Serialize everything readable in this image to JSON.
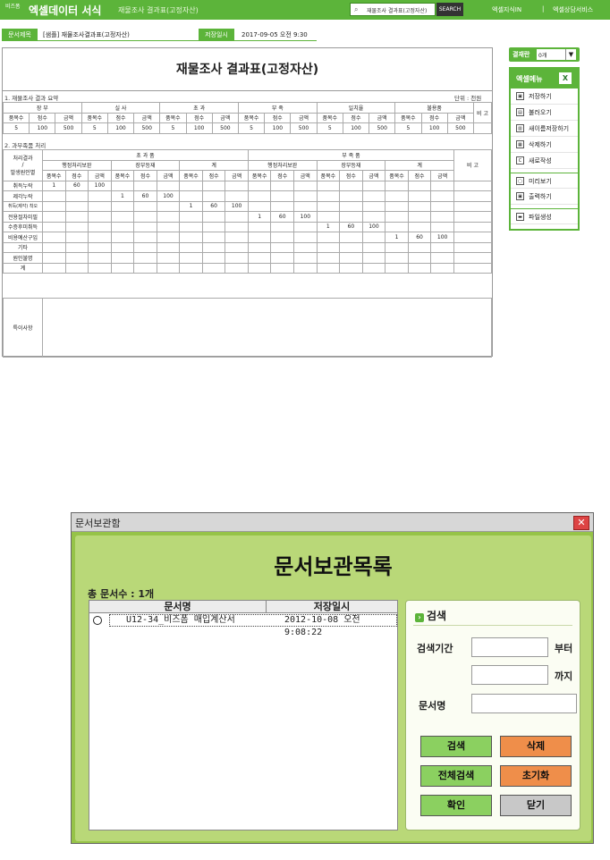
{
  "topbar": {
    "brand_small": "비즈폼",
    "brand": "엑셀데이터 서식",
    "doc_title": "재물조사 결과표(고정자산)",
    "search_value": "재물조사 결과표(고정자산)",
    "search_btn": "SEARCH",
    "link1": "엑셀지식IN",
    "sep": "|",
    "link2": "엑셀상담서비스"
  },
  "docbar": {
    "label1": "문서제목",
    "value1": "[샘플] 재물조사결과표(고정자산)",
    "label2": "저장일시",
    "value2": "2017-09-05  오전 9:30"
  },
  "sheet": {
    "title": "재물조사 결과표(고정자산)",
    "section1": "1. 재물조사 결과 요약",
    "unit": "단위 : 천원",
    "s1_groups": [
      "장 부",
      "실 사",
      "초 과",
      "부 족",
      "일치율",
      "불용품"
    ],
    "s1_note": "비 고",
    "s1_sub": [
      "품목수",
      "점수",
      "금액"
    ],
    "s1_values": [
      "5",
      "100",
      "500"
    ],
    "section2": "2. 과부족품 처리",
    "s2_rowhead": [
      "처리결과",
      "/",
      "발생원인별"
    ],
    "s2_groups": [
      "초 과 품",
      "부 족 품"
    ],
    "s2_subgroups": [
      "행정처리보완",
      "장부등재",
      "계",
      "행정처리보완",
      "장부등재",
      "계"
    ],
    "s2_note": "비 고",
    "s2_rows": [
      {
        "label": "취득누락",
        "cells": [
          "1",
          "60",
          "100",
          "",
          "",
          "",
          "",
          "",
          "",
          "",
          "",
          "",
          "",
          "",
          "",
          "",
          "",
          ""
        ]
      },
      {
        "label": "제각누락",
        "cells": [
          "",
          "",
          "",
          "1",
          "60",
          "100",
          "",
          "",
          "",
          "",
          "",
          "",
          "",
          "",
          "",
          "",
          "",
          ""
        ]
      },
      {
        "label": "취득(제각) 착오",
        "cells": [
          "",
          "",
          "",
          "",
          "",
          "",
          "1",
          "60",
          "100",
          "",
          "",
          "",
          "",
          "",
          "",
          "",
          "",
          ""
        ]
      },
      {
        "label": "전용절차미필",
        "cells": [
          "",
          "",
          "",
          "",
          "",
          "",
          "",
          "",
          "",
          "1",
          "60",
          "100",
          "",
          "",
          "",
          "",
          "",
          ""
        ]
      },
      {
        "label": "수증후미취득",
        "cells": [
          "",
          "",
          "",
          "",
          "",
          "",
          "",
          "",
          "",
          "",
          "",
          "",
          "1",
          "60",
          "100",
          "",
          "",
          ""
        ]
      },
      {
        "label": "비용예산구입",
        "cells": [
          "",
          "",
          "",
          "",
          "",
          "",
          "",
          "",
          "",
          "",
          "",
          "",
          "",
          "",
          "",
          "1",
          "60",
          "100"
        ]
      },
      {
        "label": "기타",
        "cells": [
          "",
          "",
          "",
          "",
          "",
          "",
          "",
          "",
          "",
          "",
          "",
          "",
          "",
          "",
          "",
          "",
          "",
          ""
        ]
      },
      {
        "label": "원인불명",
        "cells": [
          "",
          "",
          "",
          "",
          "",
          "",
          "",
          "",
          "",
          "",
          "",
          "",
          "",
          "",
          "",
          "",
          "",
          ""
        ]
      },
      {
        "label": "계",
        "cells": [
          "",
          "",
          "",
          "",
          "",
          "",
          "",
          "",
          "",
          "",
          "",
          "",
          "",
          "",
          "",
          "",
          "",
          ""
        ]
      }
    ],
    "special": "특이사항"
  },
  "side": {
    "sel_label": "결재란",
    "sel_value": "0개",
    "menu_title": "엑셀메뉴",
    "xl": "X",
    "items": [
      "저장하기",
      "불러오기",
      "새이름저장하기",
      "삭제하기",
      "새로작성",
      "미리보기",
      "출력하기",
      "파일생성"
    ]
  },
  "dialog": {
    "window_title": "문서보관함",
    "close": "✕",
    "title": "문서보관목록",
    "count": "총 문서수 : 1개",
    "col_name": "문서명",
    "col_date": "저장일시",
    "row_name": "U12-34_비즈폼 매입계산서",
    "row_date": "2012-10-08 오전 9:08:22",
    "search_title": "검색",
    "period_label": "검색기간",
    "from": "부터",
    "to": "까지",
    "name_label": "문서명",
    "buttons": {
      "search": "검색",
      "delete": "삭제",
      "all_search": "전체검색",
      "reset": "초기화",
      "ok": "확인",
      "close": "닫기"
    }
  },
  "colors": {
    "accent": "#5cb43a",
    "dialog_bg": "#96c348",
    "btn_green": "#8bd060",
    "btn_orange": "#ef8e4a"
  }
}
